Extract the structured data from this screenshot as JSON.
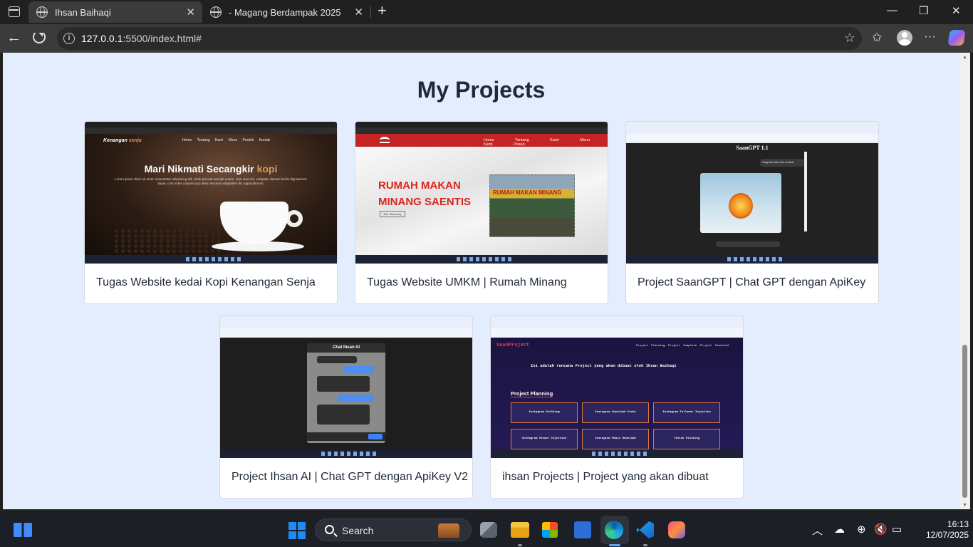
{
  "browser": {
    "tabs": [
      {
        "title": "Ihsan Baihaqi",
        "active": true
      },
      {
        "title": "- Magang Berdampak 2025",
        "active": false
      }
    ],
    "new_tab_label": "+",
    "close_glyph": "✕",
    "url_host": "127.0.0.1",
    "url_rest": ":5500/index.html#",
    "window_controls": [
      "—",
      "❐",
      "✕"
    ]
  },
  "page": {
    "section_title": "My Projects",
    "projects": [
      {
        "caption": "Tugas Website kedai Kopi Kenangan Senja",
        "preview": {
          "brand_main": "Kenangan ",
          "brand_accent": "senja",
          "nav": "Home Tentang Kami Menu Produk Kontak",
          "hero_main": "Mari Nikmati Secangkir ",
          "hero_accent": "kopi",
          "hero_sub": "Lorem ipsum dolor sit amet consectetur adipisicing elit. Unde placeat suscipit autem, nam sunt nisi, voluptate deleniti facilis dignissimos atque, cum nobis corporis quo alias nesciunt voluptatem illo culpa laborum."
        }
      },
      {
        "caption": "Tugas Website UMKM | Rumah Minang",
        "preview": {
          "nav": "Home Tentang Kami Menu Kami Pesan",
          "title_line1": "RUMAH MAKAN",
          "title_line2": "MINANG SAENTIS",
          "button": "Beli Sekarang"
        }
      },
      {
        "caption": "Project SaanGPT | Chat GPT dengan ApiKey",
        "preview": {
          "heading": "SaanGPT 1.1",
          "bubble": "image fire ball in the ice land"
        }
      },
      {
        "caption": "Project Ihsan AI | Chat GPT dengan ApiKey V2",
        "preview": {
          "heading": "Chat Ihsan AI",
          "send": "Kirim"
        }
      },
      {
        "caption": "ihsan Projects | Project yang akan dibuat",
        "preview": {
          "logo": "SaanProject",
          "nav": "Project Planning  Project Complete  Project Canceled",
          "intro": "Ini adalah rencana Project yang akan dibuat oleh Ihsan Baihaqi",
          "section": "Project Planning",
          "boxes": [
            "Instagram Stalking",
            "Instagram Download Vidio",
            "Instagram Follower Injection",
            "Instagram Viewer Injection",
            "Instagram Music Download",
            "Tiktok Stalking"
          ]
        }
      }
    ]
  },
  "taskbar": {
    "search_label": "Search",
    "time": "16:13",
    "date": "12/07/2025",
    "apps": [
      "task-view-icon",
      "file-explorer-icon",
      "microsoft-store-icon",
      "myhp-icon",
      "edge-icon",
      "vscode-icon",
      "creative-cloud-icon"
    ],
    "tray": [
      "chevron-up-icon",
      "onedrive-icon",
      "network-icon",
      "volume-muted-icon",
      "battery-icon"
    ]
  },
  "colors": {
    "page_bg": "#e3edfe",
    "accent_coffee": "#d89a5a",
    "minang_red": "#c62424",
    "edge_active": "#58a6ff"
  }
}
